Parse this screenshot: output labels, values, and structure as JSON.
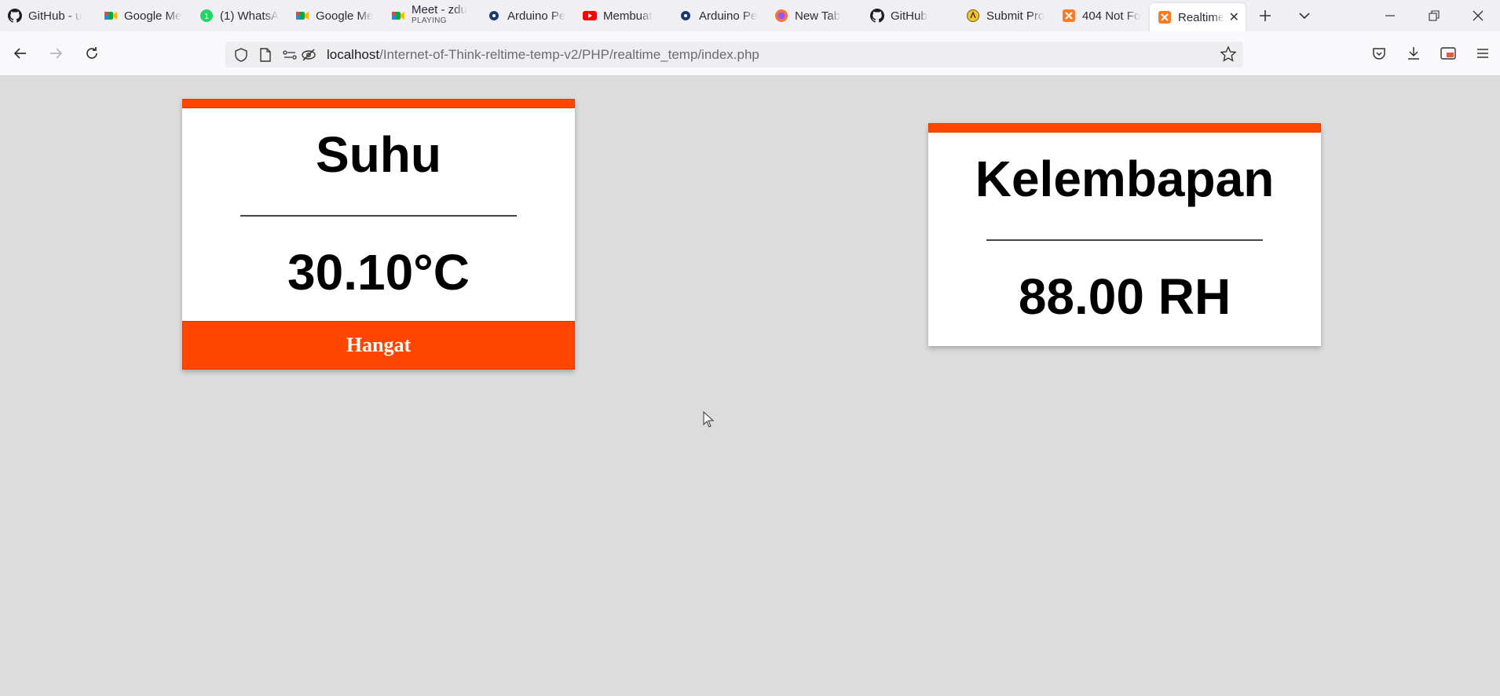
{
  "browser": {
    "tabs": [
      {
        "label": "GitHub - u",
        "icon": "github-icon"
      },
      {
        "label": "Google Me",
        "icon": "google-meet-icon"
      },
      {
        "label": "(1) WhatsA",
        "icon": "whatsapp-icon"
      },
      {
        "label": "Google Me",
        "icon": "google-meet-icon"
      },
      {
        "label": "Meet - zdu",
        "sublabel": "PLAYING",
        "icon": "google-meet-icon"
      },
      {
        "label": "Arduino Pe",
        "icon": "arduino-icon"
      },
      {
        "label": "Membuat",
        "icon": "youtube-icon"
      },
      {
        "label": "Arduino Pe",
        "icon": "arduino-icon"
      },
      {
        "label": "New Tab",
        "icon": "firefox-icon"
      },
      {
        "label": "GitHub",
        "icon": "github-icon"
      },
      {
        "label": "Submit Pro",
        "icon": "submit-icon"
      },
      {
        "label": "404 Not Fo",
        "icon": "xampp-icon"
      },
      {
        "label": "Realtime",
        "icon": "xampp-icon",
        "active": true
      }
    ],
    "url_host": "localhost",
    "url_path": "/Internet-of-Think-reltime-temp-v2/PHP/realtime_temp/index.php"
  },
  "temperature_card": {
    "title": "Suhu",
    "value": "30.10°C",
    "status": "Hangat"
  },
  "humidity_card": {
    "title": "Kelembapan",
    "value": "88.00 RH"
  },
  "colors": {
    "accent": "#ff4500",
    "background": "#dcdcdc"
  }
}
